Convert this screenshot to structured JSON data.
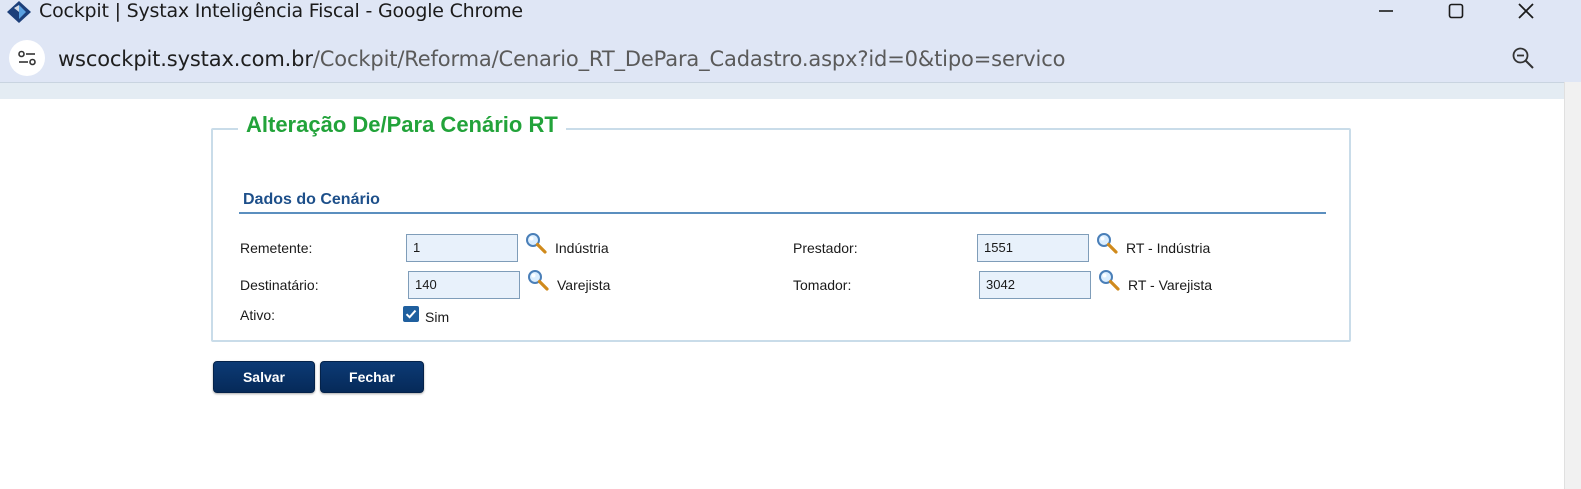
{
  "browser": {
    "window_title": "Cockpit | Systax Inteligência Fiscal - Google Chrome",
    "url_host": "wscockpit.systax.com.br",
    "url_path": "/Cockpit/Reforma/Cenario_RT_DePara_Cadastro.aspx?id=0&tipo=servico"
  },
  "form": {
    "legend": "Alteração De/Para Cenário RT",
    "section_title": "Dados do Cenário",
    "remetente": {
      "label": "Remetente:",
      "value": "1",
      "description": "Indústria"
    },
    "destinatario": {
      "label": "Destinatário:",
      "value": "140",
      "description": "Varejista"
    },
    "prestador": {
      "label": "Prestador:",
      "value": "1551",
      "description": "RT - Indústria"
    },
    "tomador": {
      "label": "Tomador:",
      "value": "3042",
      "description": "RT - Varejista"
    },
    "ativo": {
      "label": "Ativo:",
      "checked": true,
      "option_label": "Sim"
    }
  },
  "actions": {
    "save_label": "Salvar",
    "close_label": "Fechar"
  },
  "colors": {
    "legend": "#22a33a",
    "section_title": "#1d4f8a",
    "button": "#0a3570",
    "field_bg": "#e8f1fb"
  },
  "icons": {
    "app": "systax-logo-icon",
    "minimize": "minimize-icon",
    "maximize": "maximize-icon",
    "close": "close-icon",
    "site_info": "site-settings-icon",
    "zoom": "zoom-icon",
    "lookup": "magnifier-lookup-icon",
    "checkbox": "check-icon"
  }
}
